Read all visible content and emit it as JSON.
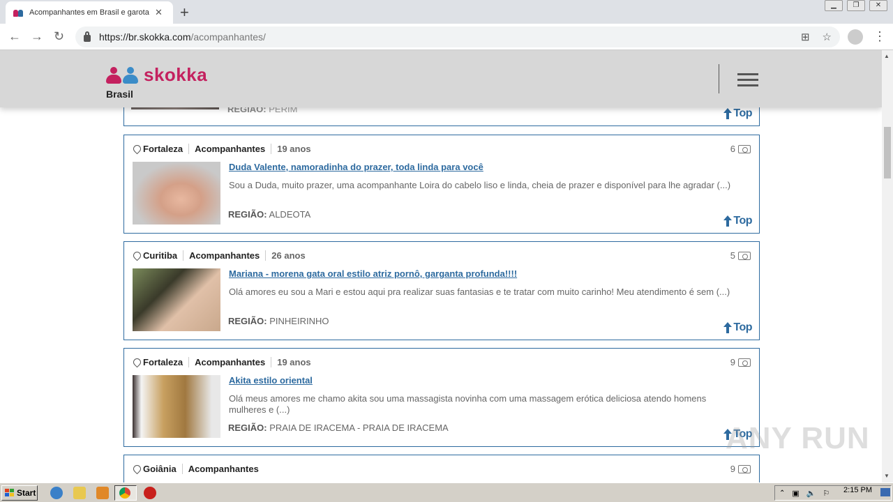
{
  "browser": {
    "tab_title": "Acompanhantes em Brasil e garotas",
    "url_domain": "https://br.skokka.com",
    "url_path": "/acompanhantes/"
  },
  "site": {
    "logo_text": "skokka",
    "logo_subtitle": "Brasil",
    "brand_color": "#c4215f",
    "accent_color": "#2d6a9f"
  },
  "partial_listing": {
    "region_label": "REGIÃO:",
    "region_value": "PERIM",
    "badge": "Top"
  },
  "listings": [
    {
      "city": "Fortaleza",
      "category": "Acompanhantes",
      "age": "19 anos",
      "photos": "6",
      "title": "Duda Valente, namoradinha do prazer, toda linda para você",
      "description": "Sou a Duda, muito prazer, uma acompanhante Loira do cabelo liso e linda, cheia de prazer e disponível para lhe agradar (...)",
      "region_label": "REGIÃO:",
      "region_value": "ALDEOTA",
      "badge": "Top"
    },
    {
      "city": "Curitiba",
      "category": "Acompanhantes",
      "age": "26 anos",
      "photos": "5",
      "title": "Mariana - morena gata oral estilo atriz pornô, garganta profunda!!!!",
      "description": "Olá amores eu sou a Mari e estou aqui pra realizar suas fantasias e te tratar com muito carinho! Meu atendimento é sem (...)",
      "region_label": "REGIÃO:",
      "region_value": "PINHEIRINHO",
      "badge": "Top"
    },
    {
      "city": "Fortaleza",
      "category": "Acompanhantes",
      "age": "19 anos",
      "photos": "9",
      "title": "Akita estilo oriental",
      "description": "Olá meus amores me chamo akita sou uma massagista novinha com uma massagem erótica deliciosa atendo homens mulheres e (...)",
      "region_label": "REGIÃO:",
      "region_value": "PRAIA DE IRACEMA - PRAIA DE IRACEMA",
      "badge": "Top"
    },
    {
      "city": "Goiânia",
      "category": "Acompanhantes",
      "photos": "9"
    }
  ],
  "taskbar": {
    "start_label": "Start",
    "clock": "2:15 PM"
  },
  "watermark": "ANY RUN"
}
